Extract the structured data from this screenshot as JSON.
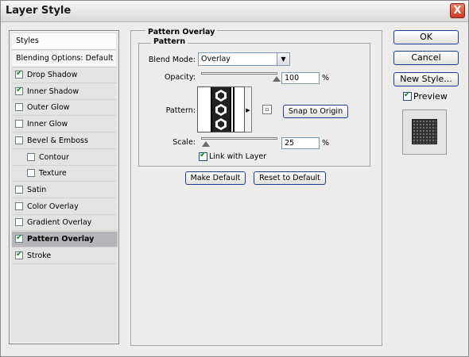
{
  "window": {
    "title": "Layer Style",
    "close_glyph": "X"
  },
  "styles_panel": {
    "header": "Styles",
    "blending_options": "Blending Options: Default",
    "items": [
      {
        "label": "Drop Shadow",
        "checked": true,
        "indent": false,
        "selected": false
      },
      {
        "label": "Inner Shadow",
        "checked": true,
        "indent": false,
        "selected": false
      },
      {
        "label": "Outer Glow",
        "checked": false,
        "indent": false,
        "selected": false
      },
      {
        "label": "Inner Glow",
        "checked": false,
        "indent": false,
        "selected": false
      },
      {
        "label": "Bevel & Emboss",
        "checked": false,
        "indent": false,
        "selected": false
      },
      {
        "label": "Contour",
        "checked": false,
        "indent": true,
        "selected": false
      },
      {
        "label": "Texture",
        "checked": false,
        "indent": true,
        "selected": false
      },
      {
        "label": "Satin",
        "checked": false,
        "indent": false,
        "selected": false
      },
      {
        "label": "Color Overlay",
        "checked": false,
        "indent": false,
        "selected": false
      },
      {
        "label": "Gradient Overlay",
        "checked": false,
        "indent": false,
        "selected": false
      },
      {
        "label": "Pattern Overlay",
        "checked": true,
        "indent": false,
        "selected": true
      },
      {
        "label": "Stroke",
        "checked": true,
        "indent": false,
        "selected": false
      }
    ]
  },
  "pattern_overlay": {
    "group_title": "Pattern Overlay",
    "sub_title": "Pattern",
    "blend_mode_label": "Blend Mode:",
    "blend_mode_value": "Overlay",
    "opacity_label": "Opacity:",
    "opacity_value": "100",
    "opacity_unit": "%",
    "opacity_fraction": 1.0,
    "pattern_label": "Pattern:",
    "snap_to_origin": "Snap to Origin",
    "scale_label": "Scale:",
    "scale_value": "25",
    "scale_unit": "%",
    "scale_fraction": 0.07,
    "link_with_layer": "Link with Layer",
    "link_with_layer_checked": true,
    "make_default": "Make Default",
    "reset_to_default": "Reset to Default"
  },
  "right_buttons": {
    "ok": "OK",
    "cancel": "Cancel",
    "new_style": "New Style...",
    "preview_label": "Preview",
    "preview_checked": true
  },
  "colors": {
    "selected_row": "#b4b4b9",
    "button_border": "#1c3f94",
    "check_mark": "#1c8c1c",
    "close_button": "#c83c25"
  },
  "icons": [
    "close-icon",
    "checkbox-icon",
    "dropdown-arrow-icon",
    "new-preset-icon",
    "slider-thumb-icon"
  ]
}
